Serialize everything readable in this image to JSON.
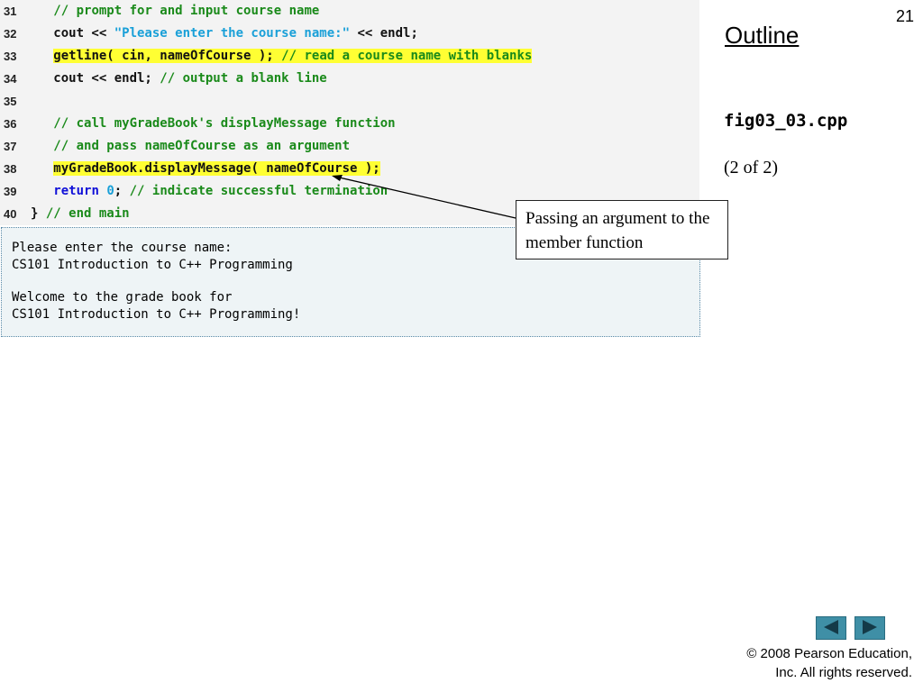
{
  "slide_number": "21",
  "outline_title": "Outline",
  "file_name": "fig03_03.cpp",
  "part_label": "(2 of 2)",
  "code_lines": [
    {
      "num": "31",
      "tokens": [
        {
          "t": "   ",
          "c": "plain"
        },
        {
          "t": "// prompt for and input course name",
          "c": "comment"
        }
      ]
    },
    {
      "num": "32",
      "tokens": [
        {
          "t": "   cout << ",
          "c": "plain"
        },
        {
          "t": "\"Please enter the course name:\"",
          "c": "string"
        },
        {
          "t": " << endl;",
          "c": "plain"
        }
      ]
    },
    {
      "num": "33",
      "tokens": [
        {
          "t": "   ",
          "c": "plain"
        },
        {
          "t": "getline( cin, nameOfCourse ); ",
          "c": "plain",
          "hl": true
        },
        {
          "t": "// read a course name with blanks",
          "c": "comment",
          "hl": true
        }
      ]
    },
    {
      "num": "34",
      "tokens": [
        {
          "t": "   cout << endl; ",
          "c": "plain"
        },
        {
          "t": "// output a blank line",
          "c": "comment"
        }
      ]
    },
    {
      "num": "35",
      "tokens": []
    },
    {
      "num": "36",
      "tokens": [
        {
          "t": "   ",
          "c": "plain"
        },
        {
          "t": "// call myGradeBook's displayMessage function",
          "c": "comment"
        }
      ]
    },
    {
      "num": "37",
      "tokens": [
        {
          "t": "   ",
          "c": "plain"
        },
        {
          "t": "// and pass nameOfCourse as an argument",
          "c": "comment"
        }
      ]
    },
    {
      "num": "38",
      "tokens": [
        {
          "t": "   ",
          "c": "plain"
        },
        {
          "t": "myGradeBook.displayMessage( nameOfCourse );",
          "c": "plain",
          "hl": true
        }
      ]
    },
    {
      "num": "39",
      "tokens": [
        {
          "t": "   ",
          "c": "plain"
        },
        {
          "t": "return",
          "c": "keyword"
        },
        {
          "t": " ",
          "c": "plain"
        },
        {
          "t": "0",
          "c": "num"
        },
        {
          "t": "; ",
          "c": "plain"
        },
        {
          "t": "// indicate successful termination",
          "c": "comment"
        }
      ]
    },
    {
      "num": "40",
      "tokens": [
        {
          "t": "} ",
          "c": "plain"
        },
        {
          "t": "// end main",
          "c": "comment"
        }
      ]
    }
  ],
  "output_lines": [
    "Please enter the course name:",
    "CS101 Introduction to C++ Programming",
    "",
    "Welcome to the grade book for",
    "CS101 Introduction to C++ Programming!"
  ],
  "callout_text": "Passing an argument to the member function",
  "nav": {
    "prev_icon": "left-triangle-icon",
    "next_icon": "right-triangle-icon"
  },
  "copyright_line1": "© 2008 Pearson Education,",
  "copyright_line2": "Inc.  All rights reserved.",
  "colors": {
    "comment": "#1a8a1a",
    "string": "#1aa0d8",
    "keyword": "#1010d8",
    "highlight": "#ffff33",
    "nav": "#3f8fa6"
  }
}
